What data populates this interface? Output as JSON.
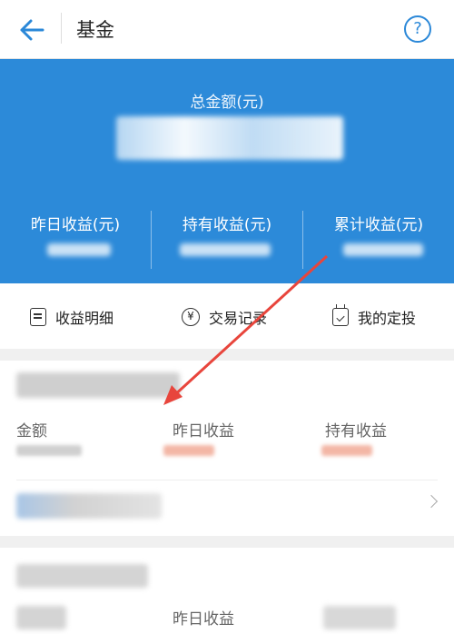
{
  "header": {
    "title": "基金",
    "back_icon": "arrow-left-icon",
    "help_glyph": "?"
  },
  "summary": {
    "total_label": "总金额(元)",
    "yesterday_label": "昨日收益(元)",
    "holding_label": "持有收益(元)",
    "cumulative_label": "累计收益(元)"
  },
  "actions": [
    {
      "label": "收益明细",
      "icon": "document-icon"
    },
    {
      "label": "交易记录",
      "icon": "yen-icon",
      "glyph": "¥"
    },
    {
      "label": "我的定投",
      "icon": "calendar-check-icon"
    }
  ],
  "fund_card_1": {
    "amount_label": "金额",
    "yesterday_label": "昨日收益",
    "holding_label": "持有收益"
  },
  "fund_card_2": {
    "yesterday_label": "昨日收益"
  },
  "colors": {
    "accent": "#2c8ad9",
    "annotation_arrow": "#e8453c",
    "gain": "#f0a08a"
  }
}
